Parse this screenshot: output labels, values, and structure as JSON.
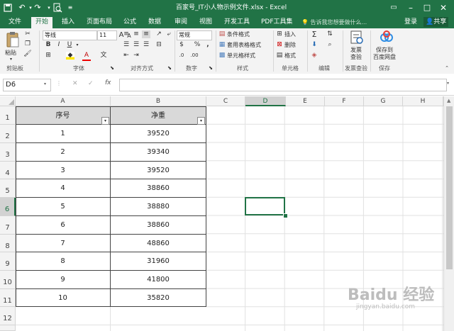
{
  "window": {
    "title": "百家号_IT小人物示例文件.xlsx - Excel",
    "save_icon": "save-icon",
    "undo_icon": "undo-icon",
    "redo_icon": "redo-icon",
    "preview_icon": "print-preview-icon"
  },
  "tabs": [
    "文件",
    "开始",
    "插入",
    "页面布局",
    "公式",
    "数据",
    "审阅",
    "视图",
    "开发工具",
    "PDF工具集"
  ],
  "active_tab": "开始",
  "tell_me": "告诉我您想要做什么...",
  "login": "登录",
  "share": "共享",
  "ribbon": {
    "paste": "粘贴",
    "font_name": "等线",
    "font_size": "11",
    "bold": "B",
    "italic": "I",
    "underline": "U",
    "font_color_glyph": "A",
    "wen": "文",
    "number_format": "常规",
    "percent": "%",
    "comma": ",",
    "conditional_format": "条件格式",
    "table_format": "套用表格格式",
    "cell_style": "单元格样式",
    "insert": "插入",
    "delete": "删除",
    "format": "格式",
    "invoice_check_1": "发票",
    "invoice_check_2": "查验",
    "save_to_1": "保存到",
    "save_to_2": "百度网盘",
    "groups": [
      "剪贴板",
      "字体",
      "对齐方式",
      "数字",
      "样式",
      "单元格",
      "编辑",
      "发票查验",
      "保存"
    ]
  },
  "formula_bar": {
    "name_box": "D6",
    "cancel": "✕",
    "enter": "✓",
    "fx": "fx",
    "content": ""
  },
  "sheet": {
    "columns": [
      "A",
      "B",
      "C",
      "D",
      "E",
      "F",
      "G",
      "H"
    ],
    "rows": [
      "1",
      "2",
      "3",
      "4",
      "5",
      "6",
      "7",
      "8",
      "9",
      "10",
      "11",
      "12"
    ],
    "active_cell": "D6",
    "active_column": "D",
    "active_row": "6",
    "header": [
      "序号",
      "净重"
    ],
    "data": [
      [
        "1",
        "39520"
      ],
      [
        "2",
        "39340"
      ],
      [
        "3",
        "39520"
      ],
      [
        "4",
        "38860"
      ],
      [
        "5",
        "38880"
      ],
      [
        "6",
        "38860"
      ],
      [
        "7",
        "48860"
      ],
      [
        "8",
        "31960"
      ],
      [
        "9",
        "41800"
      ],
      [
        "10",
        "35820"
      ]
    ]
  },
  "watermark": {
    "brand": "Baidu 经验",
    "url": "jingyan.baidu.com"
  },
  "colors": {
    "accent": "#217346",
    "header_fill": "#d9d9d9",
    "selection": "#217346"
  }
}
